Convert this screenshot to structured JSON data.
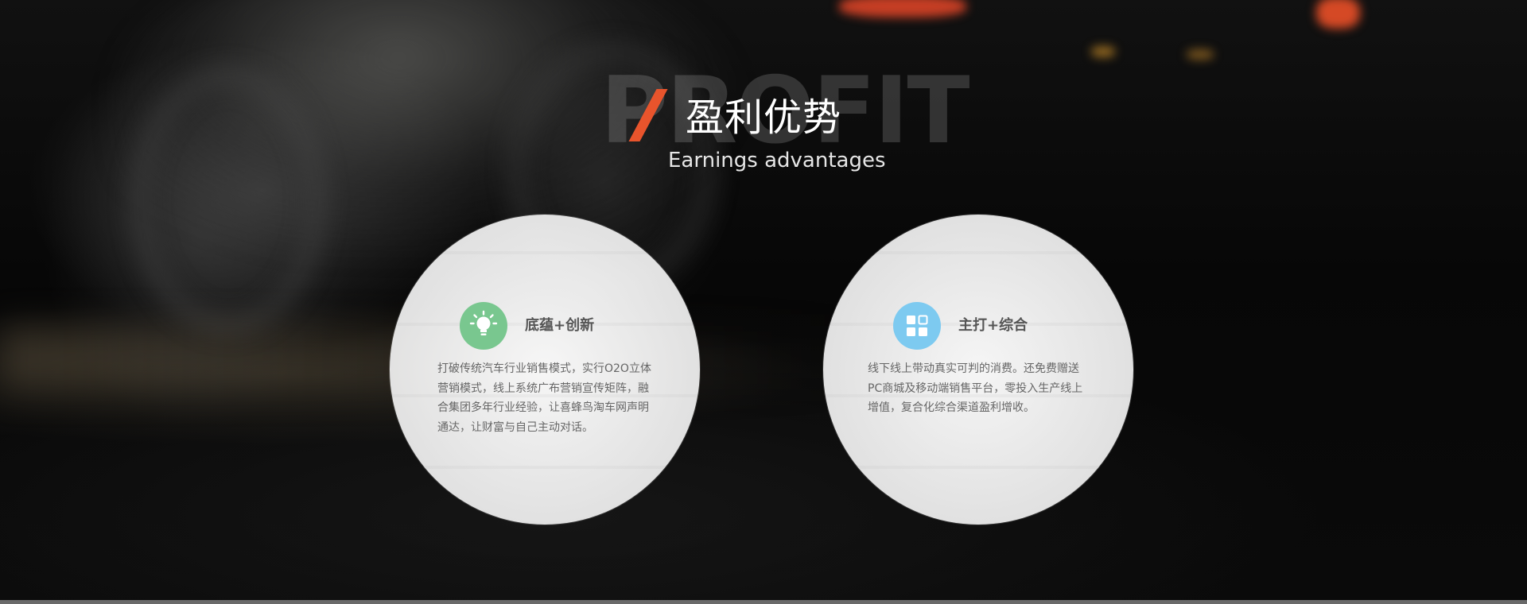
{
  "header": {
    "background_word": "PROFIT",
    "title": "盈利优势",
    "subtitle": "Earnings advantages",
    "accent_color": "#e8542c"
  },
  "cards": [
    {
      "icon": "lightbulb-icon",
      "icon_color": "#79c78f",
      "title": "底蕴+创新",
      "description": "打破传统汽车行业销售模式，实行O2O立体营销模式，线上系统广布营销宣传矩阵，融合集团多年行业经验，让喜蜂鸟淘车网声明通达，让财富与自己主动对话。"
    },
    {
      "icon": "grid-icon",
      "icon_color": "#7dcaf0",
      "title": "主打+综合",
      "description": "线下线上带动真实可判的消费。还免费赠送PC商城及移动端销售平台，零投入生产线上增值，复合化综合渠道盈利增收。"
    }
  ]
}
